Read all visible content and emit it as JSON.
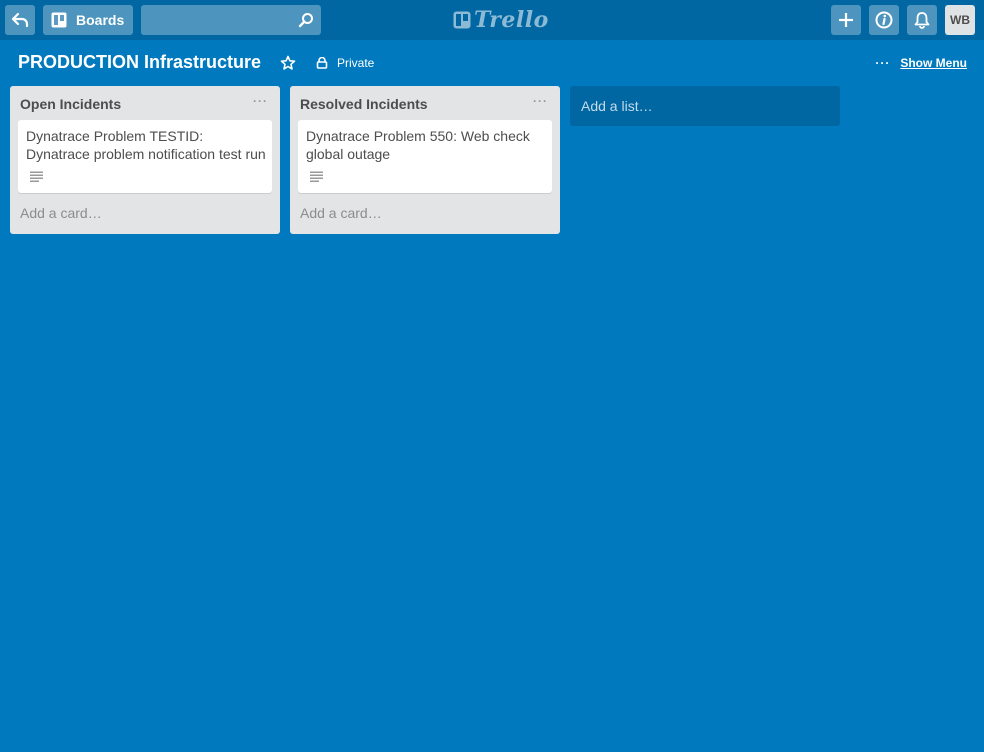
{
  "header": {
    "boards_label": "Boards",
    "search_placeholder": "",
    "logo_text": "Trello",
    "avatar_initials": "WB"
  },
  "board": {
    "title": "PRODUCTION Infrastructure",
    "visibility": "Private",
    "show_menu_label": "Show Menu",
    "menu_dots": "···"
  },
  "lists": [
    {
      "title": "Open Incidents",
      "menu_dots": "···",
      "cards": [
        {
          "title": "Dynatrace Problem TESTID: Dynatrace problem notification test run"
        }
      ],
      "add_card_label": "Add a card…"
    },
    {
      "title": "Resolved Incidents",
      "menu_dots": "···",
      "cards": [
        {
          "title": "Dynatrace Problem 550: Web check global outage"
        }
      ],
      "add_card_label": "Add a card…"
    }
  ],
  "add_list_label": "Add a list…",
  "colors": {
    "board_bg": "#0079bf",
    "header_bg": "#0067a3",
    "list_bg": "#e2e4e6"
  }
}
